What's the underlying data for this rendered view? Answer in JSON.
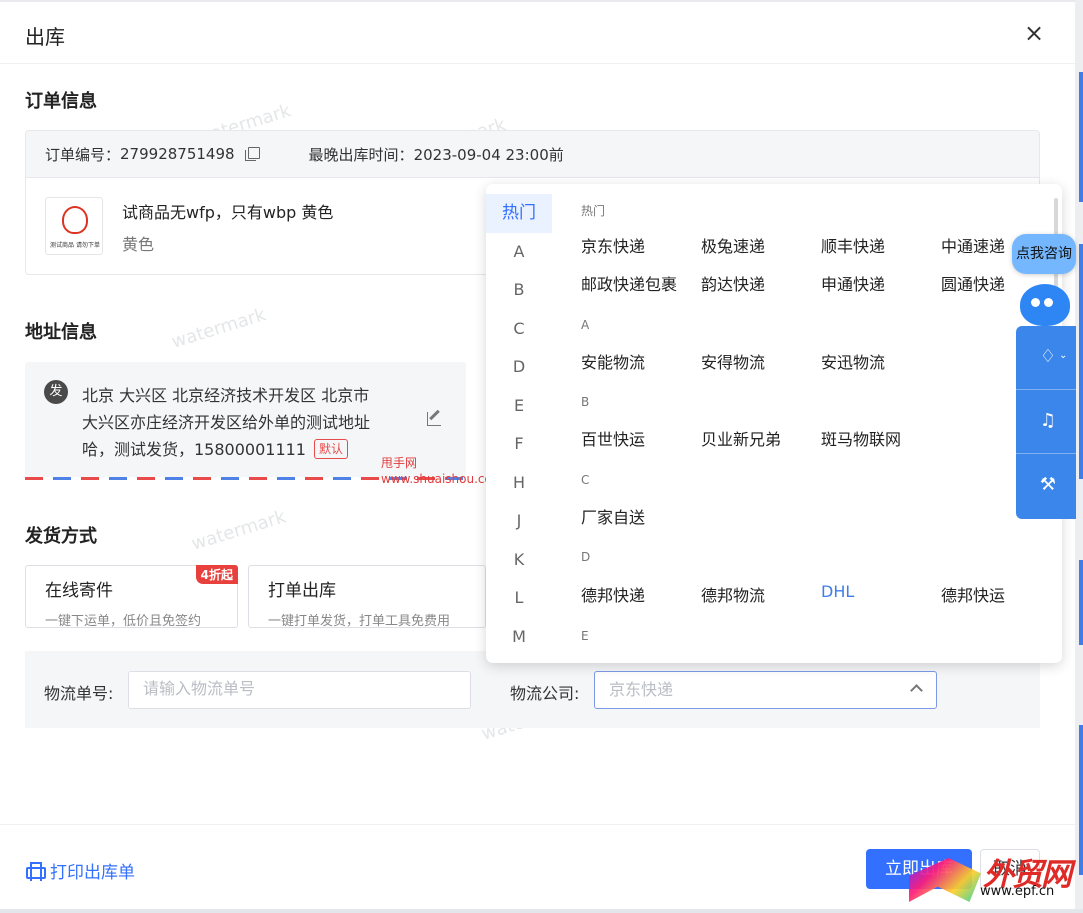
{
  "window": {
    "title": "出库"
  },
  "sections": {
    "order": "订单信息",
    "address": "地址信息",
    "shipping": "发货方式"
  },
  "order": {
    "number_label": "订单编号：",
    "number": "279928751498",
    "latest_label": "最晚出库时间：",
    "latest_time": "2023-09-04 23:00前",
    "product_name": "试商品无wfp，只有wbp 黄色",
    "product_spec": "黄色",
    "thumb_text": "测试商品 请勿下单"
  },
  "address": {
    "badge": "发",
    "line1": "北京 大兴区 北京经济技术开发区 北京市",
    "line2": "大兴区亦庄经济开发区给外单的测试地址",
    "line3": "哈，测试发货，15800001111",
    "default": "默认"
  },
  "watermarks": {
    "site_name": "甩手网",
    "site_url": "www.shuaishou.com",
    "logo_text": "外贸网",
    "logo_url": "www.epf.cn"
  },
  "shipping": {
    "options": [
      {
        "title": "在线寄件",
        "desc": "一键下运单，低价且免签约",
        "badge": "4折起"
      },
      {
        "title": "打单出库",
        "desc": "一键打单发货，打单工具免费用"
      }
    ]
  },
  "logistics": {
    "number_label": "物流单号:",
    "number_placeholder": "请输入物流单号",
    "company_label": "物流公司:",
    "company_value": "京东快递"
  },
  "footer": {
    "print_label": "打印出库单",
    "primary_label": "立即出库",
    "cancel_label": "取消"
  },
  "dropdown": {
    "alphabet": [
      "热门",
      "A",
      "B",
      "C",
      "D",
      "E",
      "F",
      "H",
      "J",
      "K",
      "L",
      "M"
    ],
    "groups": [
      {
        "title": "热门",
        "items": [
          "京东快递",
          "极兔速递",
          "顺丰快递",
          "中通速递",
          "邮政快递包裹",
          "韵达快递",
          "申通快递",
          "圆通快递"
        ]
      },
      {
        "title": "A",
        "items": [
          "安能物流",
          "安得物流",
          "安迅物流"
        ]
      },
      {
        "title": "B",
        "items": [
          "百世快运",
          "贝业新兄弟",
          "斑马物联网"
        ]
      },
      {
        "title": "C",
        "items": [
          "厂家自送"
        ]
      },
      {
        "title": "D",
        "items": [
          "德邦快递",
          "德邦物流",
          "DHL",
          "德邦快运"
        ]
      },
      {
        "title": "E",
        "items": []
      }
    ]
  },
  "side_tools": {
    "consult": "点我咨询"
  },
  "colors": {
    "primary": "#3370ff",
    "danger": "#e8413d",
    "side_blue": "#3b86ea"
  }
}
